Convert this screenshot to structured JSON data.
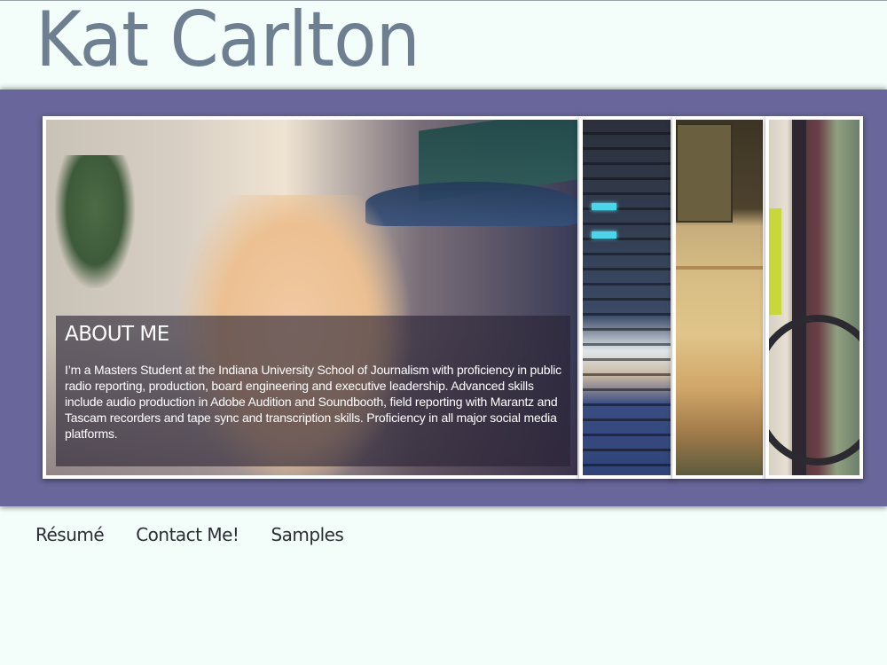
{
  "header": {
    "site_title": "Kat Carlton"
  },
  "about": {
    "heading": "ABOUT ME",
    "body": "I’m a Masters Student at the Indiana University School of Journalism with proficiency in public radio reporting, production, board engineering and executive leadership. Advanced skills include audio production in Adobe Audition and Soundbooth, field reporting with Marantz and Tascam recorders and tape sync and transcription skills. Proficiency in all major social media platforms."
  },
  "nav": {
    "items": [
      {
        "label": "Résumé"
      },
      {
        "label": "Contact Me!"
      },
      {
        "label": "Samples"
      }
    ]
  },
  "theme": {
    "background": "#f3fdf9",
    "band": "#68669a",
    "title_color": "#6e7f91",
    "overlay": "rgba(40, 34, 52, 0.62)"
  }
}
